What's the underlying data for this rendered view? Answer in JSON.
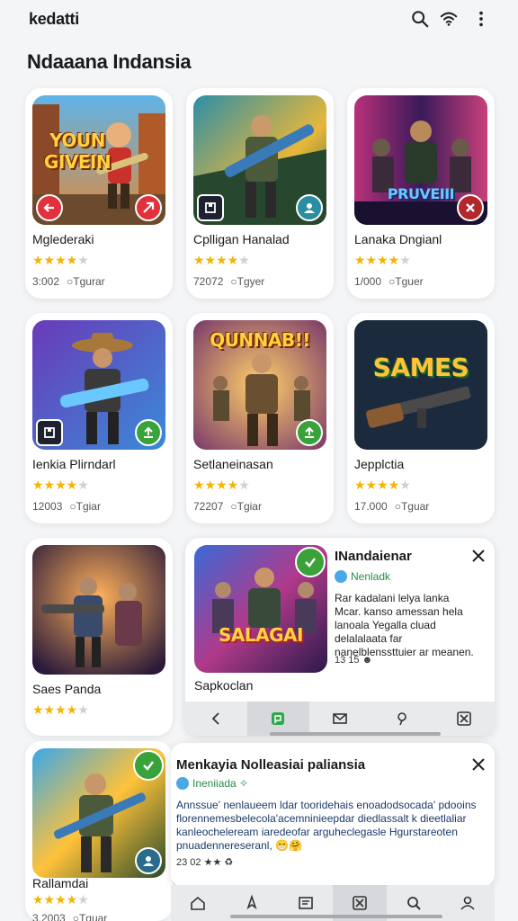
{
  "topbar": {
    "app_name": "kedatti",
    "icons": [
      "search-icon",
      "wifi-icon",
      "more-vertical-icon"
    ]
  },
  "section": {
    "title": "Ndaaana Indansia"
  },
  "cards": [
    {
      "name": "Mglederaki",
      "art_title": "YOUN GIVEIN",
      "rating": 4,
      "downloads": "3:002",
      "tag": "Tgurar",
      "badges": [
        "arrow-left-icon",
        "share-icon"
      ]
    },
    {
      "name": "Cplligan Hanalad",
      "art_title": "",
      "rating": 4,
      "downloads": "72072",
      "tag": "Tgyer",
      "badges": [
        "save-icon",
        "user-icon"
      ]
    },
    {
      "name": "Lanaka Dngianl",
      "art_title": "PRUVEIII",
      "rating": 4,
      "downloads": "1/000",
      "tag": "Tguer",
      "badges": [
        "close-icon"
      ]
    },
    {
      "name": "Ienkia Plirndarl",
      "art_title": "",
      "rating": 4,
      "downloads": "12003",
      "tag": "Tgiar",
      "badges": [
        "save-icon",
        "upload-icon"
      ]
    },
    {
      "name": "Setlaneinasan",
      "art_title": "QUNNAB!!",
      "rating": 4,
      "downloads": "72207",
      "tag": "Tgiar",
      "badges": [
        "upload-icon"
      ]
    },
    {
      "name": "Jepplctia",
      "art_title": "SAMES",
      "rating": 4,
      "downloads": "17.000",
      "tag": "Tguar",
      "badges": []
    },
    {
      "name": "Saes Panda",
      "art_title": "",
      "rating": 4,
      "downloads": "",
      "tag": "",
      "badges": []
    },
    {
      "name": "Sapkoclan",
      "art_title": "SALAGAI",
      "rating": 0,
      "downloads": "",
      "tag": "",
      "badges": [
        "check-icon"
      ]
    },
    {
      "name": "Rallamdai",
      "art_title": "",
      "rating": 4,
      "downloads": "3.2003",
      "tag": "Tguar",
      "badges": [
        "check-icon",
        "user-icon"
      ]
    }
  ],
  "detail_1": {
    "title": "INandaienar",
    "developer": "Nenladk",
    "description": "Rar kadalani lelya lanka Mcar. kanso amessan hela lanoala Yegalla cluad delalalaata far nanelblenssttuier ar meanen.",
    "stat": "13 15 ☻"
  },
  "detail_2": {
    "title": "Menkayia Nolleasiai paliansia",
    "developer": "Ineniiada ✧",
    "description": "Annssue' nenlaueem ldar tooridehais enoadodsocada' pdooins florennemesbelecola'acemninieepdar diedlassalt k dieetlaliar kanleocheleream iaredeofar arguheclegasle Hgurstareoten pnuadennereseranl, 😁🤗",
    "stat": "23 02 ★★ ♻"
  },
  "navbar_1": {
    "items": [
      "back-icon",
      "chat-icon",
      "mail-icon",
      "pin-icon",
      "close-box-icon"
    ],
    "active": 1
  },
  "navbar_2": {
    "items": [
      "home-icon",
      "explore-icon",
      "library-icon",
      "close-box-icon",
      "search-icon",
      "profile-icon"
    ],
    "active": 3
  },
  "stars_symbol": "★"
}
